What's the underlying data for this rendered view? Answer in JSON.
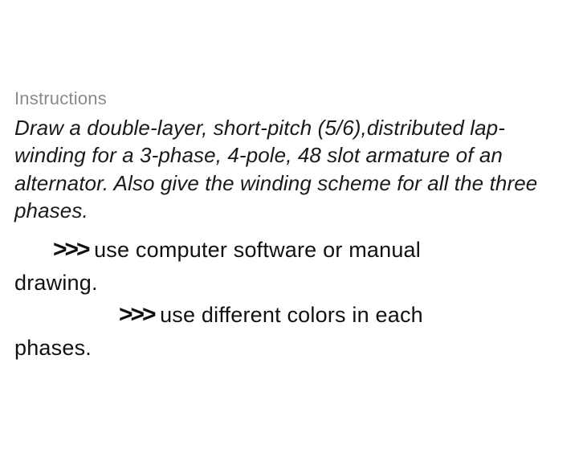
{
  "section_label": "Instructions",
  "problem": "Draw a double-layer, short-pitch (5/6),distributed lap-winding for a 3-phase, 4-pole, 48 slot armature of an alternator. Also give the winding scheme for all the three phases.",
  "arrow_glyph": ">>>",
  "note1_part1": "use computer software or manual",
  "note1_part2": "drawing.",
  "note2_part1": "use different colors in each",
  "note2_part2": "phases."
}
